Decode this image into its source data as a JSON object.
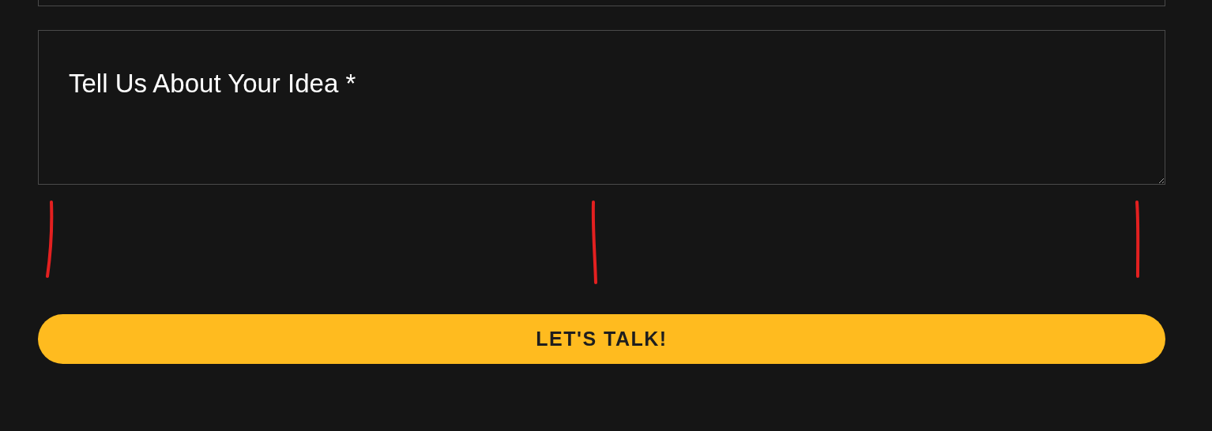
{
  "upper_field": {
    "kind": "input"
  },
  "idea_field": {
    "placeholder": "Tell Us About Your Idea *"
  },
  "annotation_marks": [
    {
      "kind": "stroke"
    },
    {
      "kind": "stroke"
    },
    {
      "kind": "stroke"
    }
  ],
  "submit_button": {
    "label": "LET'S TALK!"
  }
}
